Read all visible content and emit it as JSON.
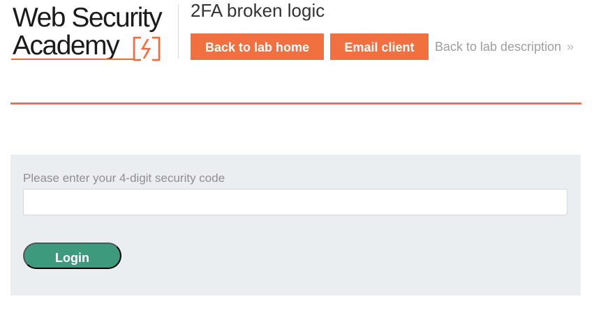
{
  "brand": {
    "line1": "Web Security",
    "line2": "Academy",
    "logo_icon": "lightning-bolt-icon",
    "accent_color": "#f07040"
  },
  "header": {
    "lab_title": "2FA broken logic",
    "back_to_lab_home_label": "Back to lab home",
    "email_client_label": "Email client",
    "back_to_lab_description_label": "Back to lab description",
    "back_to_lab_description_icon": "double-chevron-right-icon",
    "back_to_lab_description_glyph": "»"
  },
  "login_form": {
    "code_label": "Please enter your 4-digit security code",
    "code_value": "",
    "login_button_label": "Login",
    "login_button_color": "#3d9a7c"
  }
}
